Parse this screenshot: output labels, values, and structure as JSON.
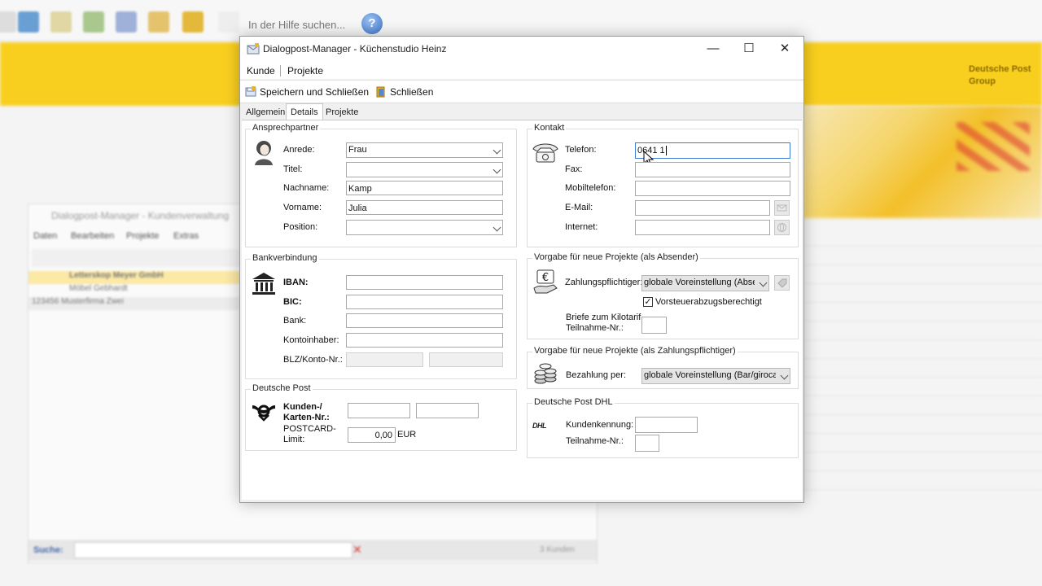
{
  "background": {
    "help_search_placeholder": "In der Hilfe suchen...",
    "help_button_label": "?",
    "brand_text_line1": "Deutsche Post",
    "brand_text_line2": "Group",
    "second_window": {
      "title": "Dialogpost-Manager - Kundenverwaltung",
      "menu": [
        "Daten",
        "Bearbeiten",
        "Projekte",
        "Extras"
      ],
      "list_rows": [
        "Letterskop Meyer GmbH",
        "Möbel Gebhardt",
        "123456 Musterfirma Zwei"
      ],
      "search_label": "Suche:",
      "count_text": "3 Kunden"
    }
  },
  "dialog": {
    "title": "Dialogpost-Manager - Küchenstudio Heinz",
    "window_buttons": {
      "minimize": "—",
      "maximize": "☐",
      "close": "✕"
    },
    "menu": {
      "kunde": "Kunde",
      "projekte": "Projekte"
    },
    "toolbar": {
      "save_close": "Speichern und Schließen",
      "close": "Schließen"
    },
    "tabs": {
      "allgemein": "Allgemein",
      "details": "Details",
      "projekte": "Projekte"
    },
    "ansprechpartner": {
      "legend": "Ansprechpartner",
      "anrede_label": "Anrede:",
      "anrede_value": "Frau",
      "titel_label": "Titel:",
      "titel_value": "",
      "nachname_label": "Nachname:",
      "nachname_value": "Kamp",
      "vorname_label": "Vorname:",
      "vorname_value": "Julia",
      "position_label": "Position:",
      "position_value": ""
    },
    "bankverbindung": {
      "legend": "Bankverbindung",
      "iban_label": "IBAN:",
      "iban_value": "",
      "bic_label": "BIC:",
      "bic_value": "",
      "bank_label": "Bank:",
      "bank_value": "",
      "kontoinhaber_label": "Kontoinhaber:",
      "kontoinhaber_value": "",
      "blz_label": "BLZ/Konto-Nr.:",
      "blz_value": "",
      "konto_value": ""
    },
    "deutsche_post": {
      "legend": "Deutsche Post",
      "kunden_label_1": "Kunden-/",
      "kunden_label_2": "Karten-Nr.:",
      "kunden_value_1": "",
      "kunden_value_2": "",
      "postcard_label_1": "POSTCARD-",
      "postcard_label_2": "Limit:",
      "postcard_value": "0,00",
      "postcard_unit": "EUR"
    },
    "kontakt": {
      "legend": "Kontakt",
      "telefon_label": "Telefon:",
      "telefon_value": "0641 1",
      "fax_label": "Fax:",
      "fax_value": "",
      "mobil_label": "Mobiltelefon:",
      "mobil_value": "",
      "email_label": "E-Mail:",
      "email_value": "",
      "internet_label": "Internet:",
      "internet_value": ""
    },
    "absender": {
      "legend": "Vorgabe für neue Projekte (als Absender)",
      "zahlungspflichtiger_label": "Zahlungspflichtiger:",
      "zahlungspflichtiger_value": "globale Voreinstellung (Abser",
      "vorsteuer_label": "Vorsteuerabzugsberechtigt",
      "vorsteuer_checked": true,
      "kilotarif_label_1": "Briefe zum Kilotarif",
      "kilotarif_label_2": "Teilnahme-Nr.:",
      "kilotarif_value": ""
    },
    "zahlungspflichtiger": {
      "legend": "Vorgabe für neue Projekte (als Zahlungspflichtiger)",
      "bezahlung_label": "Bezahlung per:",
      "bezahlung_value": "globale Voreinstellung (Bar/girocar"
    },
    "dhl": {
      "legend": "Deutsche Post DHL",
      "logo_text": "DHL",
      "kundenkennung_label": "Kundenkennung:",
      "kundenkennung_value": "",
      "teilnahme_label": "Teilnahme-Nr.:",
      "teilnahme_value": ""
    }
  }
}
